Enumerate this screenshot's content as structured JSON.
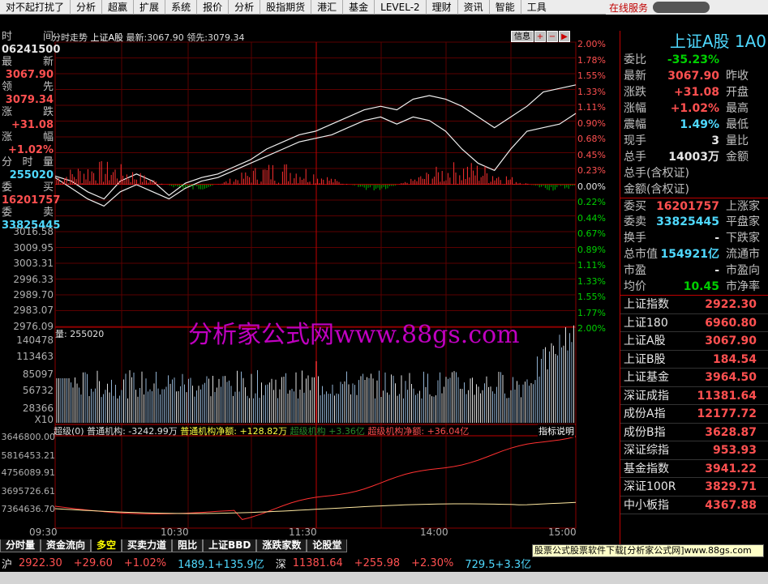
{
  "menu": [
    "对不起打扰了",
    "分析",
    "超赢",
    "扩展",
    "系统",
    "报价",
    "分析",
    "股指期货",
    "港汇",
    "基金",
    "LEVEL-2",
    "理财",
    "资讯",
    "智能",
    "工具"
  ],
  "menu_online": "在线服务",
  "chart_header": {
    "name": "分时走势",
    "market": "上证A股",
    "latest_label": "最新:",
    "latest": "3067.90",
    "lead_label": "领先:",
    "lead": "3079.34"
  },
  "info_btn": "信息",
  "left": {
    "time_label": "时　间",
    "time": "06241500",
    "latest_label": "最　新",
    "latest": "3067.90",
    "lead_label": "领　先",
    "lead": "3079.34",
    "chg_label": "涨　跌",
    "chg": "+31.08",
    "pct_label": "涨　幅",
    "pct": "+1.02%",
    "vol_label": "分时量",
    "vol": "255020",
    "bid_label": "委　买",
    "bid": "16201757",
    "ask_label": "委　卖",
    "ask": "33825445"
  },
  "price_axis": [
    "3016.58",
    "3009.95",
    "3003.31",
    "2996.33",
    "2989.70",
    "2983.07",
    "2976.09"
  ],
  "pct_axis": [
    {
      "t": "2.00%",
      "c": "red"
    },
    {
      "t": "1.78%",
      "c": "red"
    },
    {
      "t": "1.55%",
      "c": "red"
    },
    {
      "t": "1.33%",
      "c": "red"
    },
    {
      "t": "1.11%",
      "c": "red"
    },
    {
      "t": "0.90%",
      "c": "red"
    },
    {
      "t": "0.68%",
      "c": "red"
    },
    {
      "t": "0.45%",
      "c": "red"
    },
    {
      "t": "0.23%",
      "c": "red"
    },
    {
      "t": "0.00%",
      "c": "wht"
    },
    {
      "t": "0.22%",
      "c": "grn"
    },
    {
      "t": "0.44%",
      "c": "grn"
    },
    {
      "t": "0.67%",
      "c": "grn"
    },
    {
      "t": "0.89%",
      "c": "grn"
    },
    {
      "t": "1.11%",
      "c": "grn"
    },
    {
      "t": "1.33%",
      "c": "grn"
    },
    {
      "t": "1.55%",
      "c": "grn"
    },
    {
      "t": "1.77%",
      "c": "grn"
    },
    {
      "t": "2.00%",
      "c": "grn"
    }
  ],
  "vol_axis": [
    "140478",
    "113463",
    "85097",
    "56732",
    "28366",
    "X10"
  ],
  "vol_label": "量: 255020",
  "ind_axis": [
    "3646800.00",
    "5816453.21",
    "4756089.91",
    "3695726.61",
    "7364636.70"
  ],
  "indicator": {
    "a": "超级(0) 普通机构: -3242.99万",
    "b": "普通机构净额: +128.82万",
    "c": "超级机构 +3.36亿",
    "d": "超级机构净额: +36.04亿",
    "btn": "指标说明"
  },
  "time_ticks": [
    "09:30",
    "10:30",
    "11:30",
    "14:00",
    "15:00"
  ],
  "watermark": "分析家公式网www.88gs.com",
  "tabs": [
    "分时量",
    "资金流向",
    "多空",
    "买卖力道",
    "阻比",
    "上证BBD",
    "涨跌家数",
    "论股堂"
  ],
  "status": {
    "sh": "沪",
    "sh_val": "2922.30",
    "sh_chg": "+29.60",
    "sh_pct": "+1.02%",
    "sh_amt": "1489.1+135.9亿",
    "sz": "深",
    "sz_val": "11381.64",
    "sz_chg": "+255.98",
    "sz_pct": "+2.30%",
    "sz_amt": "729.5+3.3亿"
  },
  "ad": "股票公式股票软件下载[分析家公式网]www.88gs.com",
  "right": {
    "title": "上证A股 1A0",
    "rows": [
      {
        "l": "委比",
        "v": "-35.23%",
        "c": "grn",
        "r": ""
      },
      {
        "l": "最新",
        "v": "3067.90",
        "c": "red",
        "r": "昨收"
      },
      {
        "l": "涨跌",
        "v": "+31.08",
        "c": "red",
        "r": "开盘"
      },
      {
        "l": "涨幅",
        "v": "+1.02%",
        "c": "red",
        "r": "最高"
      },
      {
        "l": "震幅",
        "v": "1.49%",
        "c": "cyan",
        "r": "最低"
      },
      {
        "l": "现手",
        "v": "3",
        "c": "wht",
        "r": "量比"
      },
      {
        "l": "总手",
        "v": "14003万",
        "c": "wht",
        "r": "金额"
      },
      {
        "l": "总手(含权证)",
        "v": "",
        "c": "wht",
        "r": ""
      },
      {
        "l": "金额(含权证)",
        "v": "",
        "c": "wht",
        "r": ""
      },
      {
        "l": "委买",
        "v": "16201757",
        "c": "red",
        "r": "上涨家"
      },
      {
        "l": "委卖",
        "v": "33825445",
        "c": "cyan",
        "r": "平盘家"
      },
      {
        "l": "换手",
        "v": "-",
        "c": "wht",
        "r": "下跌家"
      },
      {
        "l": "总市值",
        "v": "154921亿",
        "c": "cyan",
        "r": "流通市"
      },
      {
        "l": "市盈",
        "v": "-",
        "c": "wht",
        "r": "市盈向"
      },
      {
        "l": "均价",
        "v": "10.45",
        "c": "grn",
        "r": "市净率"
      }
    ],
    "indices": [
      {
        "l": "上证指数",
        "v": "2922.30"
      },
      {
        "l": "上证180",
        "v": "6960.80"
      },
      {
        "l": "上证A股",
        "v": "3067.90"
      },
      {
        "l": "上证B股",
        "v": "184.54"
      },
      {
        "l": "上证基金",
        "v": "3964.50"
      },
      {
        "l": "深证成指",
        "v": "11381.64"
      },
      {
        "l": "成份A指",
        "v": "12177.72"
      },
      {
        "l": "成份B指",
        "v": "3628.87"
      },
      {
        "l": "深证综指",
        "v": "953.93"
      },
      {
        "l": "基金指数",
        "v": "3941.22"
      },
      {
        "l": "深证100R",
        "v": "3829.71"
      },
      {
        "l": "中小板指",
        "v": "4367.88"
      }
    ]
  },
  "chart_data": {
    "type": "line",
    "series": [
      {
        "values": [
          0.12,
          0.05,
          -0.1,
          -0.2,
          0.05,
          0.15,
          0.05,
          -0.15,
          0.02,
          0.1,
          0.15,
          0.25,
          0.35,
          0.5,
          0.6,
          0.7,
          0.75,
          0.85,
          0.95,
          1.05,
          1.1,
          1.05,
          1.2,
          1.25,
          1.2,
          1.1,
          0.95,
          0.8,
          0.95,
          1.1,
          1.3,
          1.35,
          1.4
        ]
      },
      {
        "values": [
          0.1,
          -0.05,
          -0.2,
          -0.3,
          -0.1,
          0.0,
          -0.1,
          -0.2,
          -0.05,
          0.05,
          0.1,
          0.2,
          0.3,
          0.4,
          0.5,
          0.6,
          0.65,
          0.7,
          0.8,
          0.9,
          0.95,
          0.85,
          0.95,
          0.9,
          0.75,
          0.5,
          0.3,
          0.2,
          0.5,
          0.75,
          0.8,
          0.85,
          1.0
        ]
      }
    ]
  }
}
